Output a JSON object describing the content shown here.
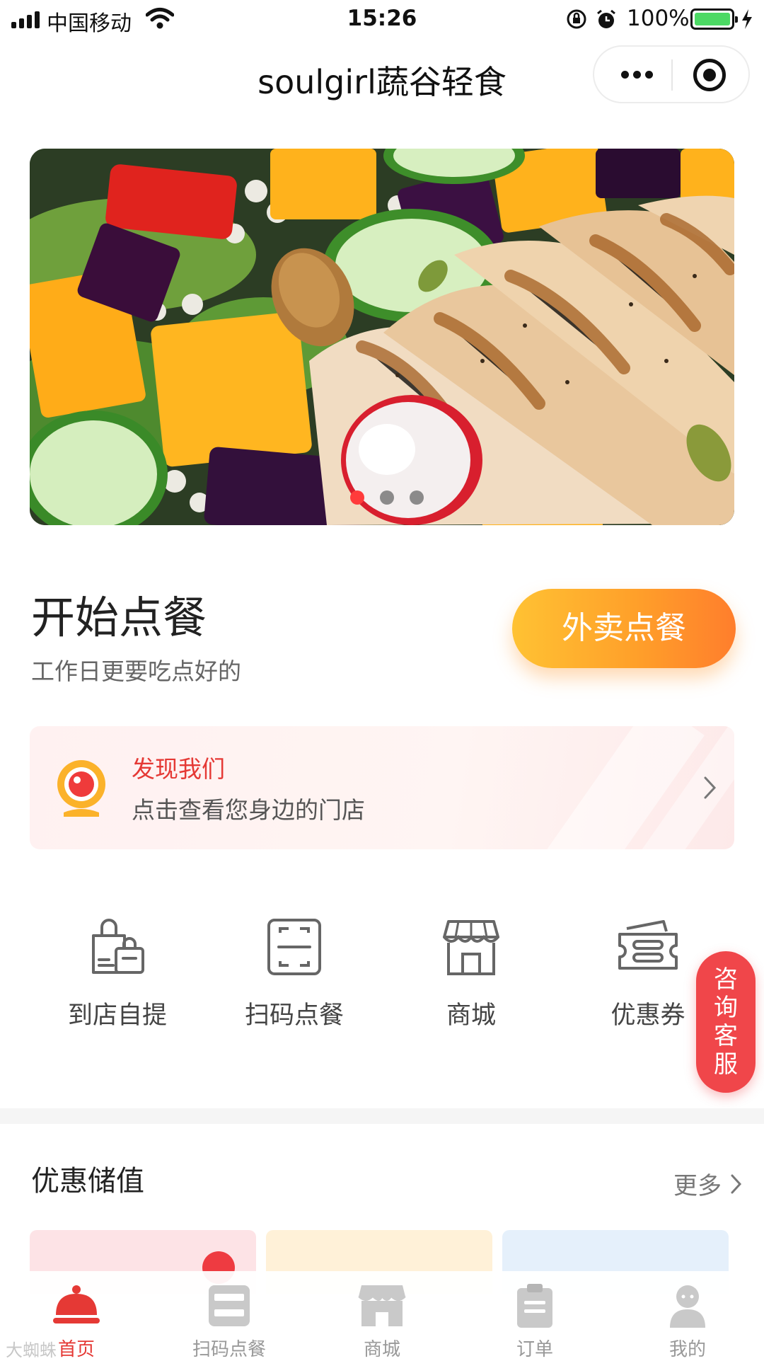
{
  "status_bar": {
    "carrier": "中国移动",
    "time": "15:26",
    "battery": "100%"
  },
  "nav": {
    "title": "soulgirl蔬谷轻食"
  },
  "banner": {
    "slide_count": 4,
    "active_slide": 1
  },
  "ordering": {
    "title": "开始点餐",
    "subtitle": "工作日更要吃点好的",
    "delivery_label": "外卖点餐"
  },
  "discover": {
    "title": "发现我们",
    "subtitle": "点击查看您身边的门店"
  },
  "quick_menu": {
    "items": [
      {
        "label": "到店自提",
        "icon": "shopping-bags-icon"
      },
      {
        "label": "扫码点餐",
        "icon": "scan-frame-icon"
      },
      {
        "label": "商城",
        "icon": "storefront-icon"
      },
      {
        "label": "优惠券",
        "icon": "coupon-ticket-icon"
      }
    ]
  },
  "service": {
    "label": "咨询客服"
  },
  "stored_value": {
    "title": "优惠储值",
    "more": "更多"
  },
  "tabbar": {
    "items": [
      {
        "label": "首页",
        "icon": "food-cloche-icon",
        "active": true
      },
      {
        "label": "扫码点餐",
        "icon": "scan-order-icon",
        "active": false
      },
      {
        "label": "商城",
        "icon": "store-icon",
        "active": false
      },
      {
        "label": "订单",
        "icon": "clipboard-icon",
        "active": false
      },
      {
        "label": "我的",
        "icon": "user-icon",
        "active": false
      }
    ]
  },
  "watermark": "大蜘蛛",
  "colors": {
    "accent_red": "#e53935",
    "delivery_gradient_start": "#ffc233",
    "delivery_gradient_end": "#ff7e2c",
    "battery_green": "#4cd964"
  }
}
